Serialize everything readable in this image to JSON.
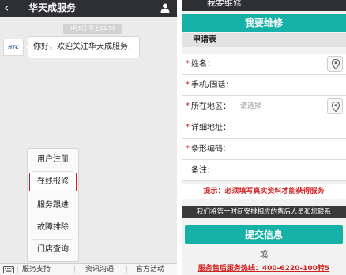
{
  "chat": {
    "back_icon": "chevron-left-icon",
    "title": "华天成服务",
    "user_icon": "person-icon",
    "timestamp": "9月5日 早上11:58",
    "avatar_logo": "HTC",
    "welcome_message": "你好，欢迎关注华天成服务！",
    "popup_menu": [
      {
        "label": "用户注册"
      },
      {
        "label": "在线报修",
        "highlight_color": "#d32020"
      },
      {
        "label": "服务跟进"
      },
      {
        "label": "故障排除"
      },
      {
        "label": "门店查询"
      }
    ],
    "keyboard_icon": "keyboard-icon",
    "menu_bar": [
      {
        "label": "服务支持"
      },
      {
        "label": "资讯沟通"
      },
      {
        "label": "官方活动"
      }
    ]
  },
  "form": {
    "top_title": "我要维修",
    "header_title": "我要维修",
    "section_title": "申请表",
    "fields": [
      {
        "required": "*",
        "label": "姓名：",
        "placeholder": "",
        "has_location": true
      },
      {
        "required": "*",
        "label": "手机/固话：",
        "placeholder": "",
        "has_location": false
      },
      {
        "required": "*",
        "label": "所在地区：",
        "placeholder": "请选择",
        "has_location": true
      },
      {
        "required": "*",
        "label": "详细地址：",
        "placeholder": "",
        "has_location": false
      },
      {
        "required": "*",
        "label": "条形编码：",
        "placeholder": "",
        "has_location": false
      },
      {
        "required": "",
        "label": "备注：",
        "placeholder": "",
        "has_location": false
      }
    ],
    "hint": "提示：必须填写真实资料才能获得服务",
    "notice": "我们将第一时间安排相应的售后人员和您联系",
    "submit_label": "提交信息",
    "or_label": "或",
    "hotline": "服务售后服务热线：400-6220-100转5",
    "location_icon": "location-pin-icon"
  },
  "colors": {
    "accent_teal": "#15b1a6",
    "alert_red": "#d32020",
    "dark_bar": "#2d2f33"
  }
}
